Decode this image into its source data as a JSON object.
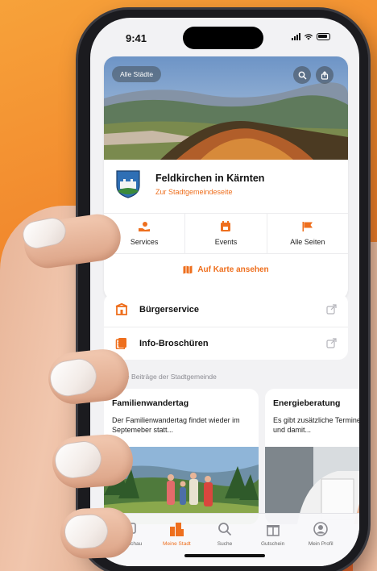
{
  "status": {
    "time": "9:41"
  },
  "header": {
    "all_cities_label": "Alle Städte"
  },
  "town": {
    "name": "Feldkirchen in Kärnten",
    "link": "Zur Stadtgemeindeseite"
  },
  "quick_actions": [
    {
      "label": "Services",
      "icon": "hand-service-icon"
    },
    {
      "label": "Events",
      "icon": "calendar-icon"
    },
    {
      "label": "Alle Seiten",
      "icon": "flag-icon"
    }
  ],
  "map_button": {
    "label": "Auf Karte ansehen",
    "icon": "map-icon"
  },
  "links": [
    {
      "label": "Bürgerservice",
      "icon": "building-icon"
    },
    {
      "label": "Info-Broschüren",
      "icon": "brochure-icon"
    }
  ],
  "news_section_title": "Neueste Beiträge der Stadtgemeinde",
  "news": [
    {
      "title": "Familienwandertag",
      "teaser": "Der Familienwandertag findet wieder im Septemeber statt..."
    },
    {
      "title": "Energieberatung",
      "teaser": "Es gibt zusätzliche Termine für die Energie und damit..."
    }
  ],
  "tabs": [
    {
      "label": "Rundschau",
      "icon": "news-icon",
      "active": false
    },
    {
      "label": "Meine Stadt",
      "icon": "city-icon",
      "active": true
    },
    {
      "label": "Suche",
      "icon": "search-icon",
      "active": false
    },
    {
      "label": "Gutschein",
      "icon": "gift-icon",
      "active": false
    },
    {
      "label": "Mein Profil",
      "icon": "profile-icon",
      "active": false
    }
  ],
  "colors": {
    "accent": "#ee6f1e",
    "background": "#f0822a"
  }
}
